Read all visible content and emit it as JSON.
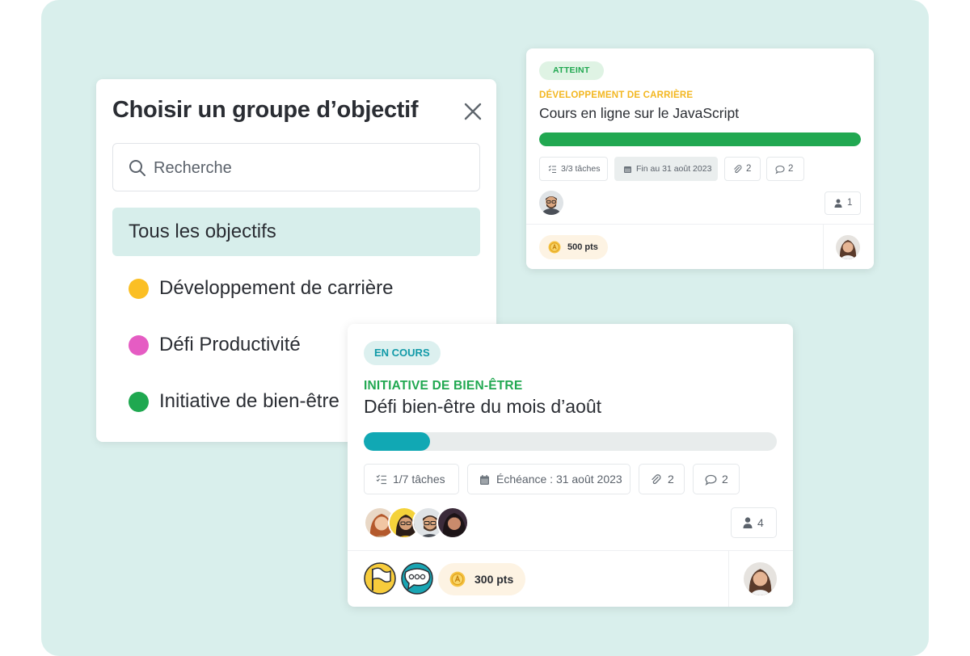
{
  "panel": {
    "title": "Choisir un groupe d’objectif",
    "search_placeholder": "Recherche",
    "all_label": "Tous les objectifs",
    "groups": [
      {
        "label": "Développement de carrière",
        "color": "#fbbf24"
      },
      {
        "label": "Défi Productivité",
        "color": "#e55cc3"
      },
      {
        "label": "Initiative de bien-être",
        "color": "#1fa850"
      }
    ]
  },
  "card_small": {
    "status": "ATTEINT",
    "category": "DÉVELOPPEMENT DE CARRIÈRE",
    "title": "Cours en ligne sur le JavaScript",
    "progress": 1.0,
    "tasks": "3/3 tâches",
    "deadline": "Fin au 31 août 2023",
    "attachments": "2",
    "comments": "2",
    "members": "1",
    "points": "500 pts",
    "colors": {
      "status": "#21a851",
      "category": "#f3b721",
      "progress": "#21a851"
    }
  },
  "card_large": {
    "status": "EN COURS",
    "category": "INITIATIVE DE BIEN-ÊTRE",
    "title": "Défi bien-être du mois d’août",
    "progress": 0.16,
    "tasks": "1/7 tâches",
    "deadline": "Échéance : 31 août 2023",
    "attachments": "2",
    "comments": "2",
    "members": "4",
    "points": "300 pts",
    "colors": {
      "status": "#119aa8",
      "category": "#21a851",
      "progress": "#11a8b4"
    }
  },
  "icons": [
    "search-icon",
    "close-icon",
    "checklist-icon",
    "calendar-icon",
    "paperclip-icon",
    "comment-icon",
    "user-icon",
    "coin-icon",
    "flag-badge-icon",
    "chat-badge-icon"
  ]
}
